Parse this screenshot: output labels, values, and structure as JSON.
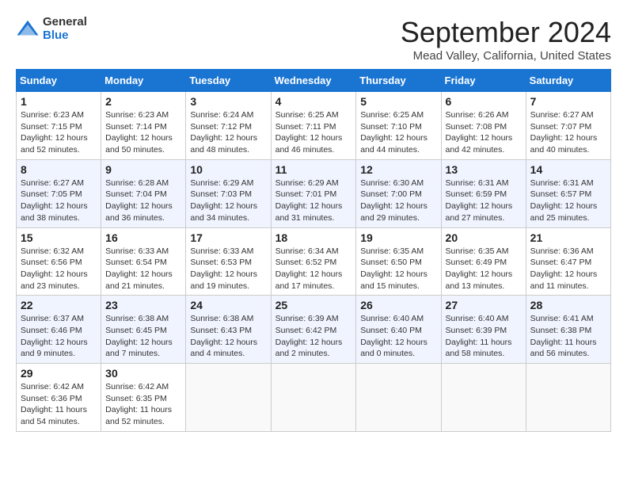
{
  "logo": {
    "general": "General",
    "blue": "Blue"
  },
  "title": "September 2024",
  "location": "Mead Valley, California, United States",
  "weekdays": [
    "Sunday",
    "Monday",
    "Tuesday",
    "Wednesday",
    "Thursday",
    "Friday",
    "Saturday"
  ],
  "weeks": [
    [
      {
        "day": "1",
        "info": "Sunrise: 6:23 AM\nSunset: 7:15 PM\nDaylight: 12 hours\nand 52 minutes."
      },
      {
        "day": "2",
        "info": "Sunrise: 6:23 AM\nSunset: 7:14 PM\nDaylight: 12 hours\nand 50 minutes."
      },
      {
        "day": "3",
        "info": "Sunrise: 6:24 AM\nSunset: 7:12 PM\nDaylight: 12 hours\nand 48 minutes."
      },
      {
        "day": "4",
        "info": "Sunrise: 6:25 AM\nSunset: 7:11 PM\nDaylight: 12 hours\nand 46 minutes."
      },
      {
        "day": "5",
        "info": "Sunrise: 6:25 AM\nSunset: 7:10 PM\nDaylight: 12 hours\nand 44 minutes."
      },
      {
        "day": "6",
        "info": "Sunrise: 6:26 AM\nSunset: 7:08 PM\nDaylight: 12 hours\nand 42 minutes."
      },
      {
        "day": "7",
        "info": "Sunrise: 6:27 AM\nSunset: 7:07 PM\nDaylight: 12 hours\nand 40 minutes."
      }
    ],
    [
      {
        "day": "8",
        "info": "Sunrise: 6:27 AM\nSunset: 7:05 PM\nDaylight: 12 hours\nand 38 minutes."
      },
      {
        "day": "9",
        "info": "Sunrise: 6:28 AM\nSunset: 7:04 PM\nDaylight: 12 hours\nand 36 minutes."
      },
      {
        "day": "10",
        "info": "Sunrise: 6:29 AM\nSunset: 7:03 PM\nDaylight: 12 hours\nand 34 minutes."
      },
      {
        "day": "11",
        "info": "Sunrise: 6:29 AM\nSunset: 7:01 PM\nDaylight: 12 hours\nand 31 minutes."
      },
      {
        "day": "12",
        "info": "Sunrise: 6:30 AM\nSunset: 7:00 PM\nDaylight: 12 hours\nand 29 minutes."
      },
      {
        "day": "13",
        "info": "Sunrise: 6:31 AM\nSunset: 6:59 PM\nDaylight: 12 hours\nand 27 minutes."
      },
      {
        "day": "14",
        "info": "Sunrise: 6:31 AM\nSunset: 6:57 PM\nDaylight: 12 hours\nand 25 minutes."
      }
    ],
    [
      {
        "day": "15",
        "info": "Sunrise: 6:32 AM\nSunset: 6:56 PM\nDaylight: 12 hours\nand 23 minutes."
      },
      {
        "day": "16",
        "info": "Sunrise: 6:33 AM\nSunset: 6:54 PM\nDaylight: 12 hours\nand 21 minutes."
      },
      {
        "day": "17",
        "info": "Sunrise: 6:33 AM\nSunset: 6:53 PM\nDaylight: 12 hours\nand 19 minutes."
      },
      {
        "day": "18",
        "info": "Sunrise: 6:34 AM\nSunset: 6:52 PM\nDaylight: 12 hours\nand 17 minutes."
      },
      {
        "day": "19",
        "info": "Sunrise: 6:35 AM\nSunset: 6:50 PM\nDaylight: 12 hours\nand 15 minutes."
      },
      {
        "day": "20",
        "info": "Sunrise: 6:35 AM\nSunset: 6:49 PM\nDaylight: 12 hours\nand 13 minutes."
      },
      {
        "day": "21",
        "info": "Sunrise: 6:36 AM\nSunset: 6:47 PM\nDaylight: 12 hours\nand 11 minutes."
      }
    ],
    [
      {
        "day": "22",
        "info": "Sunrise: 6:37 AM\nSunset: 6:46 PM\nDaylight: 12 hours\nand 9 minutes."
      },
      {
        "day": "23",
        "info": "Sunrise: 6:38 AM\nSunset: 6:45 PM\nDaylight: 12 hours\nand 7 minutes."
      },
      {
        "day": "24",
        "info": "Sunrise: 6:38 AM\nSunset: 6:43 PM\nDaylight: 12 hours\nand 4 minutes."
      },
      {
        "day": "25",
        "info": "Sunrise: 6:39 AM\nSunset: 6:42 PM\nDaylight: 12 hours\nand 2 minutes."
      },
      {
        "day": "26",
        "info": "Sunrise: 6:40 AM\nSunset: 6:40 PM\nDaylight: 12 hours\nand 0 minutes."
      },
      {
        "day": "27",
        "info": "Sunrise: 6:40 AM\nSunset: 6:39 PM\nDaylight: 11 hours\nand 58 minutes."
      },
      {
        "day": "28",
        "info": "Sunrise: 6:41 AM\nSunset: 6:38 PM\nDaylight: 11 hours\nand 56 minutes."
      }
    ],
    [
      {
        "day": "29",
        "info": "Sunrise: 6:42 AM\nSunset: 6:36 PM\nDaylight: 11 hours\nand 54 minutes."
      },
      {
        "day": "30",
        "info": "Sunrise: 6:42 AM\nSunset: 6:35 PM\nDaylight: 11 hours\nand 52 minutes."
      },
      {
        "day": "",
        "info": ""
      },
      {
        "day": "",
        "info": ""
      },
      {
        "day": "",
        "info": ""
      },
      {
        "day": "",
        "info": ""
      },
      {
        "day": "",
        "info": ""
      }
    ]
  ]
}
